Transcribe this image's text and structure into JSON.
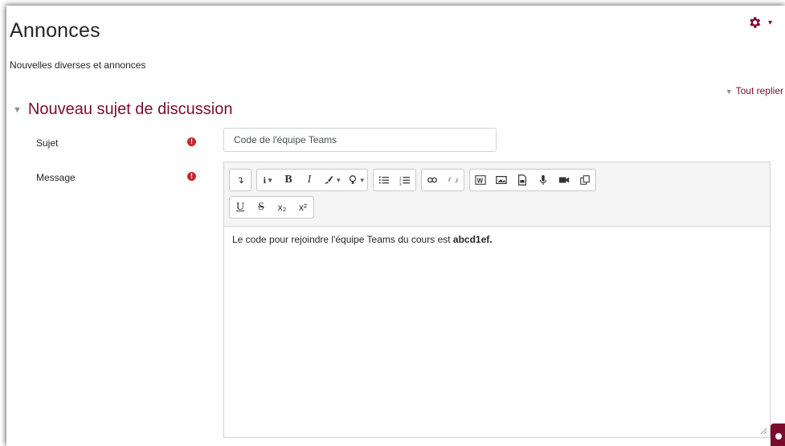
{
  "header": {
    "title": "Annonces",
    "subtitle": "Nouvelles diverses et annonces"
  },
  "actions": {
    "collapse_all": "Tout replier"
  },
  "form": {
    "section_title": "Nouveau sujet de discussion",
    "subject_label": "Sujet",
    "subject_value": "Code de l'équipe Teams",
    "message_label": "Message",
    "message_text": "Le code pour rejoindre l'équipe Teams du cours est ",
    "message_bold": "abcd1ef."
  },
  "toolbar": {
    "row1": [
      {
        "name": "show-more-buttons-icon",
        "glyph": "↴"
      },
      {
        "name": "paragraph-styles-icon",
        "glyph": "i"
      },
      {
        "name": "bold-icon",
        "glyph": "B"
      },
      {
        "name": "italic-icon",
        "glyph": "I"
      },
      {
        "name": "font-color-icon",
        "glyph": "🖌"
      },
      {
        "name": "background-color-icon",
        "glyph": "💡"
      },
      {
        "name": "unordered-list-icon",
        "glyph": "≔"
      },
      {
        "name": "ordered-list-icon",
        "glyph": "⅓"
      },
      {
        "name": "link-icon",
        "glyph": "🔗"
      },
      {
        "name": "unlink-icon",
        "glyph": "⛓"
      },
      {
        "name": "word-import-icon",
        "glyph": "W"
      },
      {
        "name": "image-icon",
        "glyph": "▣"
      },
      {
        "name": "media-icon",
        "glyph": "▤"
      },
      {
        "name": "record-audio-icon",
        "glyph": "🎙"
      },
      {
        "name": "record-video-icon",
        "glyph": "🎥"
      },
      {
        "name": "copy-icon",
        "glyph": "⧉"
      }
    ],
    "row2": [
      {
        "name": "underline-icon",
        "glyph": "U"
      },
      {
        "name": "strikethrough-icon",
        "glyph": "S"
      },
      {
        "name": "subscript-icon",
        "glyph": "x₂"
      },
      {
        "name": "superscript-icon",
        "glyph": "x²"
      }
    ]
  },
  "colors": {
    "accent": "#7a0c2e",
    "required": "#c62828",
    "toolbar_bg": "#f5f5f5"
  }
}
